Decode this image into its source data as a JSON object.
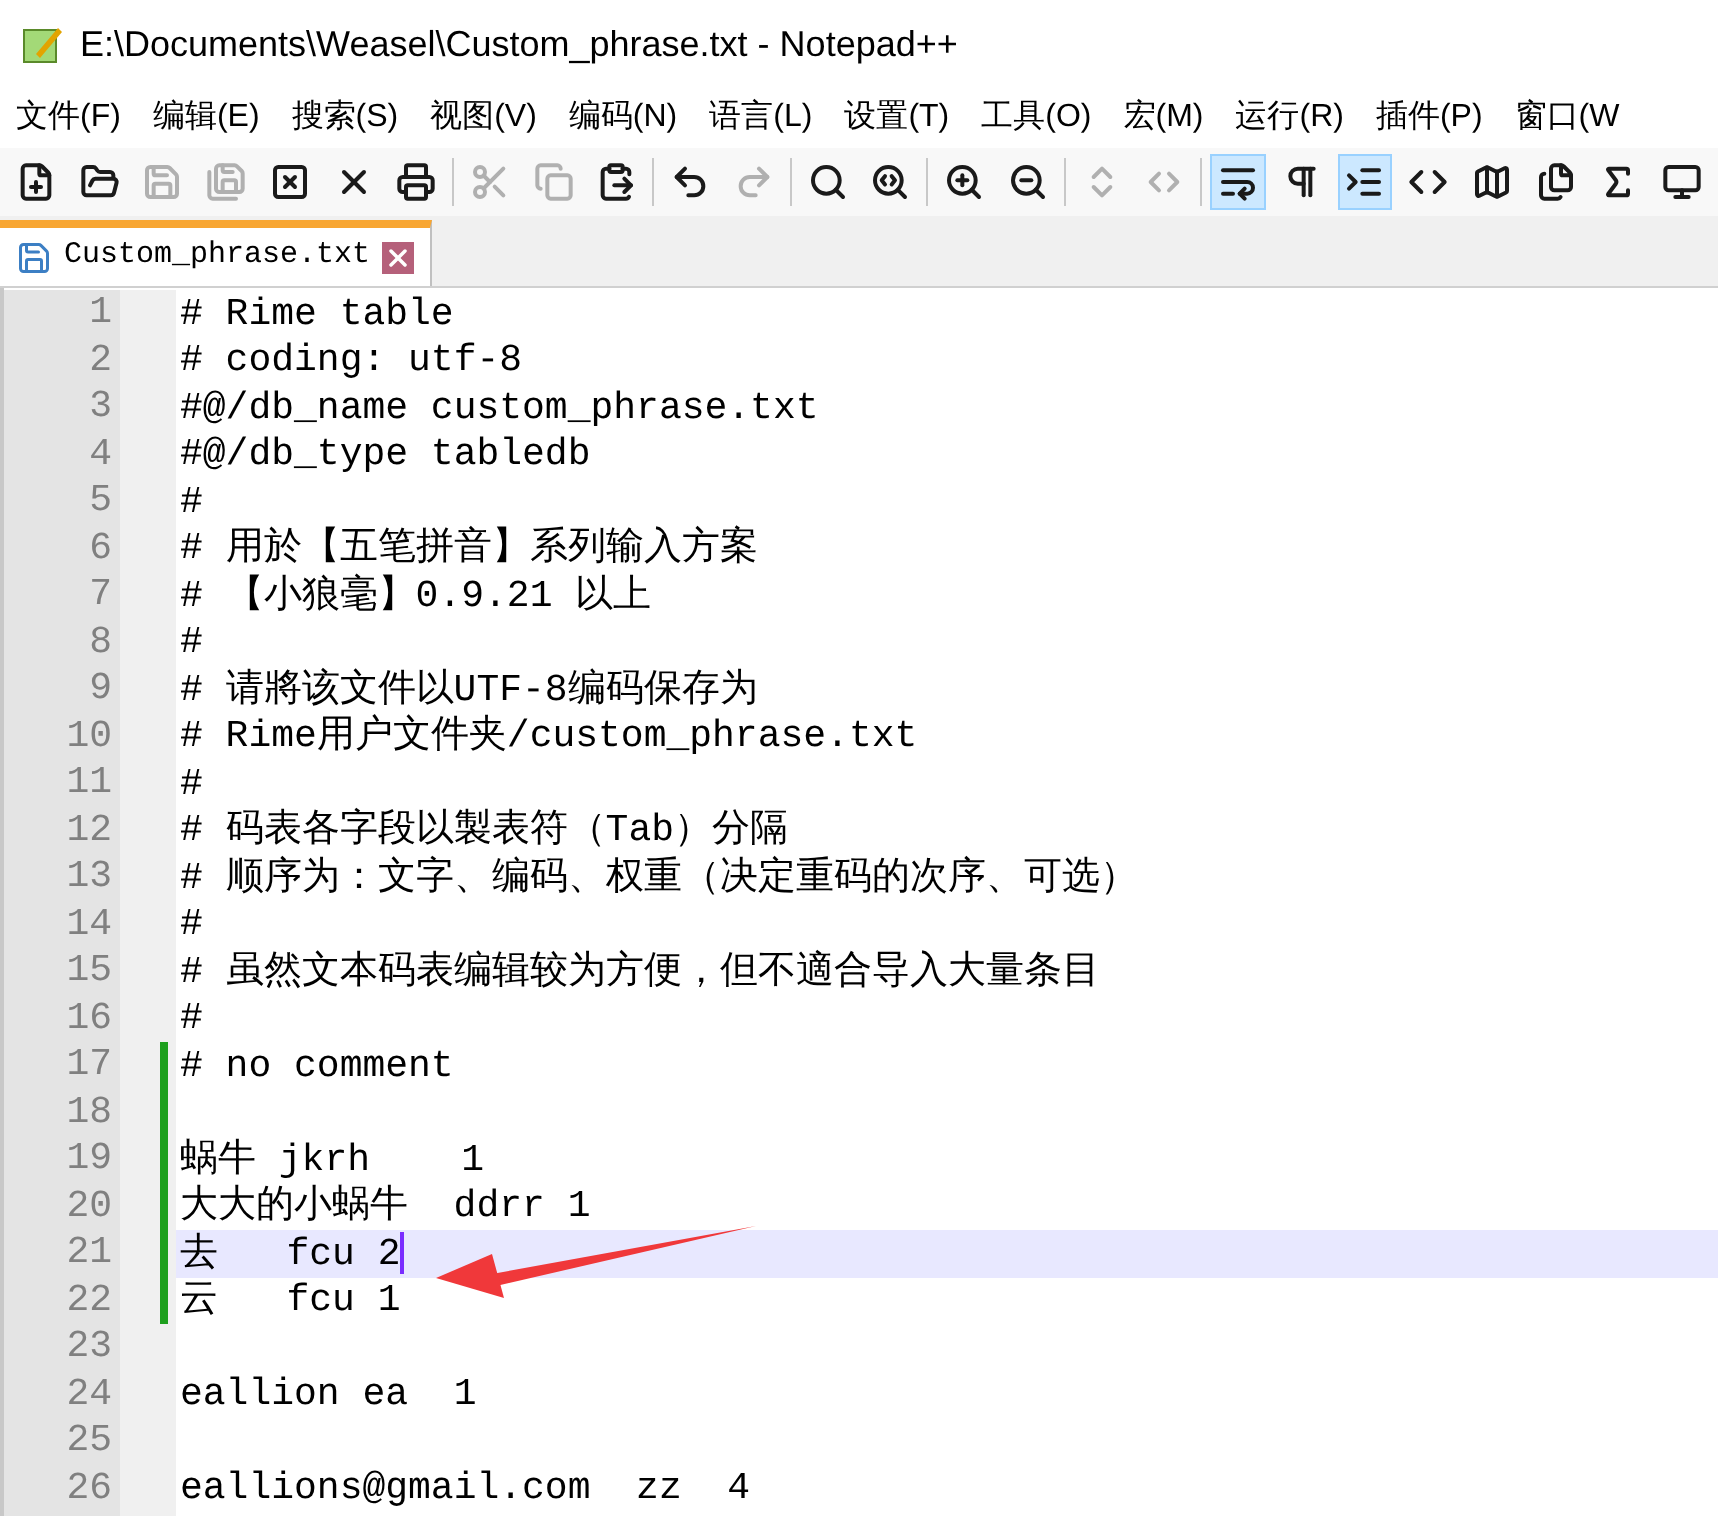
{
  "window": {
    "title": "E:\\Documents\\Weasel\\Custom_phrase.txt - Notepad++"
  },
  "menu": [
    "文件(F)",
    "编辑(E)",
    "搜索(S)",
    "视图(V)",
    "编码(N)",
    "语言(L)",
    "设置(T)",
    "工具(O)",
    "宏(M)",
    "运行(R)",
    "插件(P)",
    "窗口(W"
  ],
  "toolbar": [
    {
      "kind": "new",
      "disabled": false,
      "on": false
    },
    {
      "kind": "open",
      "disabled": false,
      "on": false
    },
    {
      "kind": "save",
      "disabled": true,
      "on": false
    },
    {
      "kind": "saveall",
      "disabled": true,
      "on": false
    },
    {
      "kind": "close",
      "disabled": false,
      "on": false
    },
    {
      "kind": "closeall",
      "disabled": false,
      "on": false
    },
    {
      "kind": "print",
      "disabled": false,
      "on": false
    },
    {
      "kind": "sep"
    },
    {
      "kind": "cut",
      "disabled": true,
      "on": false
    },
    {
      "kind": "copy",
      "disabled": true,
      "on": false
    },
    {
      "kind": "paste",
      "disabled": false,
      "on": false
    },
    {
      "kind": "sep"
    },
    {
      "kind": "undo",
      "disabled": false,
      "on": false
    },
    {
      "kind": "redo",
      "disabled": true,
      "on": false
    },
    {
      "kind": "sep"
    },
    {
      "kind": "find",
      "disabled": false,
      "on": false
    },
    {
      "kind": "replace",
      "disabled": false,
      "on": false
    },
    {
      "kind": "sep"
    },
    {
      "kind": "zoomin",
      "disabled": false,
      "on": false
    },
    {
      "kind": "zoomout",
      "disabled": false,
      "on": false
    },
    {
      "kind": "sep"
    },
    {
      "kind": "sync",
      "disabled": true,
      "on": false
    },
    {
      "kind": "synch",
      "disabled": true,
      "on": false
    },
    {
      "kind": "sep"
    },
    {
      "kind": "wrap",
      "disabled": false,
      "on": true
    },
    {
      "kind": "pilcrow",
      "disabled": false,
      "on": false
    },
    {
      "kind": "indent",
      "disabled": false,
      "on": true
    },
    {
      "kind": "code",
      "disabled": false,
      "on": false
    },
    {
      "kind": "map",
      "disabled": false,
      "on": false
    },
    {
      "kind": "docs",
      "disabled": false,
      "on": false
    },
    {
      "kind": "fx",
      "disabled": false,
      "on": false
    },
    {
      "kind": "monitor",
      "disabled": false,
      "on": false
    }
  ],
  "tabs": [
    {
      "label": "Custom_phrase.txt",
      "selected": true
    }
  ],
  "editor": {
    "lines": [
      {
        "number": "1",
        "text": "# Rime table",
        "changed": false,
        "selected": false
      },
      {
        "number": "2",
        "text": "# coding: utf-8",
        "changed": false,
        "selected": false
      },
      {
        "number": "3",
        "text": "#@/db_name custom_phrase.txt",
        "changed": false,
        "selected": false
      },
      {
        "number": "4",
        "text": "#@/db_type tabledb",
        "changed": false,
        "selected": false
      },
      {
        "number": "5",
        "text": "#",
        "changed": false,
        "selected": false
      },
      {
        "number": "6",
        "text": "# 用於【五笔拼音】系列输入方案",
        "changed": false,
        "selected": false
      },
      {
        "number": "7",
        "text": "# 【小狼毫】0.9.21 以上",
        "changed": false,
        "selected": false
      },
      {
        "number": "8",
        "text": "#",
        "changed": false,
        "selected": false
      },
      {
        "number": "9",
        "text": "# 请將该文件以UTF-8编码保存为",
        "changed": false,
        "selected": false
      },
      {
        "number": "10",
        "text": "# Rime用户文件夹/custom_phrase.txt",
        "changed": false,
        "selected": false
      },
      {
        "number": "11",
        "text": "#",
        "changed": false,
        "selected": false
      },
      {
        "number": "12",
        "text": "# 码表各字段以製表符（Tab）分隔",
        "changed": false,
        "selected": false
      },
      {
        "number": "13",
        "text": "# 顺序为：文字、编码、权重（决定重码的次序、可选）",
        "changed": false,
        "selected": false
      },
      {
        "number": "14",
        "text": "#",
        "changed": false,
        "selected": false
      },
      {
        "number": "15",
        "text": "# 虽然文本码表编辑较为方便，但不適合导入大量条目",
        "changed": false,
        "selected": false
      },
      {
        "number": "16",
        "text": "#",
        "changed": false,
        "selected": false
      },
      {
        "number": "17",
        "text": "# no comment",
        "changed": true,
        "selected": false
      },
      {
        "number": "18",
        "changed": true,
        "selected": false
      },
      {
        "number": "19",
        "text": "蜗牛 jkrh    1",
        "changed": true,
        "selected": false
      },
      {
        "number": "20",
        "text": "大大的小蜗牛  ddrr 1",
        "changed": true,
        "selected": false
      },
      {
        "number": "21",
        "text": "去   fcu 2",
        "changed": true,
        "selected": true
      },
      {
        "number": "22",
        "text": "云   fcu 1",
        "changed": true,
        "selected": false
      },
      {
        "number": "23",
        "changed": false,
        "selected": false
      },
      {
        "number": "24",
        "text": "eallion ea  1",
        "changed": false,
        "selected": false
      },
      {
        "number": "25",
        "changed": false,
        "selected": false
      },
      {
        "number": "26",
        "text": "eallions@gmail.com  zz  4",
        "changed": false,
        "selected": false
      }
    ]
  }
}
